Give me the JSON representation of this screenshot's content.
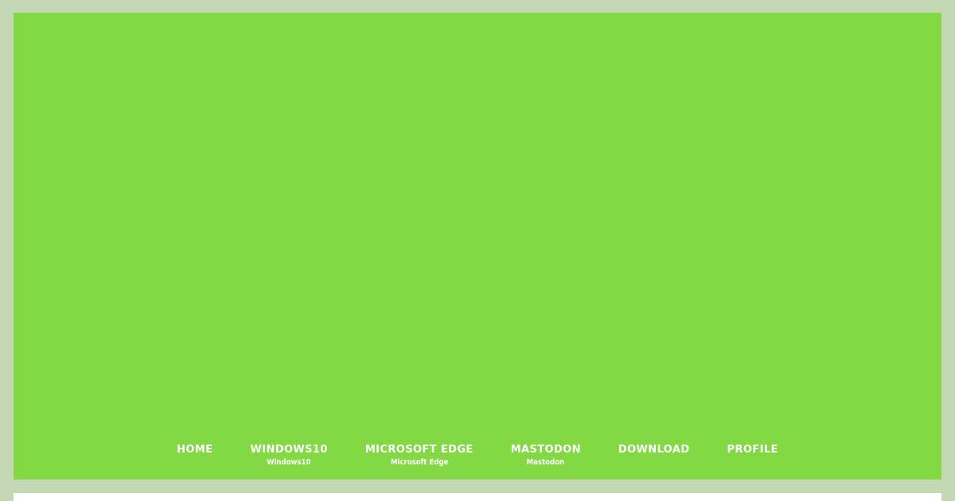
{
  "colors": {
    "page_background": "#c5d8b6",
    "header_background": "#83d944",
    "nav_text": "#ffffff",
    "content_background": "#ffffff"
  },
  "nav": {
    "items": [
      {
        "label": "HOME",
        "sub": ""
      },
      {
        "label": "WINDOWS10",
        "sub": "Windows10"
      },
      {
        "label": "MICROSOFT EDGE",
        "sub": "Microsoft Edge"
      },
      {
        "label": "MASTODON",
        "sub": "Mastodon"
      },
      {
        "label": "DOWNLOAD",
        "sub": ""
      },
      {
        "label": "PROFILE",
        "sub": ""
      }
    ]
  }
}
